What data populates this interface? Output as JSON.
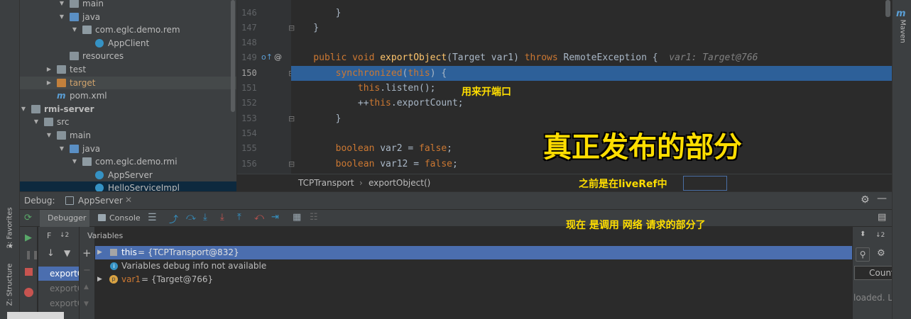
{
  "tree": {
    "rows": [
      {
        "label": "main",
        "kind": "folder"
      },
      {
        "label": "java",
        "kind": "folder-blue"
      },
      {
        "label": "com.eglc.demo.rem",
        "kind": "pkg"
      },
      {
        "label": "AppClient",
        "kind": "cls"
      },
      {
        "label": "resources",
        "kind": "folder"
      },
      {
        "label": "test",
        "kind": "folder"
      },
      {
        "label": "target",
        "kind": "folder-orange"
      },
      {
        "label": "pom.xml",
        "kind": "mvn"
      },
      {
        "label": "rmi-server",
        "kind": "folder"
      },
      {
        "label": "src",
        "kind": "folder"
      },
      {
        "label": "main",
        "kind": "folder"
      },
      {
        "label": "java",
        "kind": "folder-blue"
      },
      {
        "label": "com.eglc.demo.rmi",
        "kind": "pkg"
      },
      {
        "label": "AppServer",
        "kind": "cls"
      },
      {
        "label": "HelloServiceImpl",
        "kind": "cls"
      }
    ]
  },
  "editor": {
    "lines": [
      {
        "num": "146",
        "code": "        }"
      },
      {
        "num": "147",
        "code": "    }"
      },
      {
        "num": "148",
        "code": ""
      },
      {
        "num": "149",
        "code": "    public void exportObject(Target var1) throws RemoteException {  var1: Target@766"
      },
      {
        "num": "150",
        "code": "        synchronized(this) {"
      },
      {
        "num": "151",
        "code": "            this.listen();"
      },
      {
        "num": "152",
        "code": "            ++this.exportCount;"
      },
      {
        "num": "153",
        "code": "        }"
      },
      {
        "num": "154",
        "code": ""
      },
      {
        "num": "155",
        "code": "        boolean var2 = false;"
      },
      {
        "num": "156",
        "code": "        boolean var12 = false;"
      }
    ],
    "line149": {
      "kw1": "public void ",
      "fn": "exportObject",
      "mid": "(Target var1) ",
      "kw2": "throws",
      "rest": " RemoteException {  ",
      "hint": "var1: Target@766"
    },
    "line150": {
      "kw": "synchronized",
      "a": "(",
      "b": "this",
      "c": ") {"
    },
    "line151": {
      "kw": "this",
      "rest": ".listen();"
    },
    "line152": {
      "pre": "++",
      "kw": "this",
      "rest": ".exportCount;"
    },
    "line155": {
      "kw": "boolean",
      "rest": " var2 = ",
      "val": "false",
      "end": ";"
    },
    "line156": {
      "kw": "boolean",
      "rest": " var12 = ",
      "val": "false",
      "end": ";"
    }
  },
  "breadcrumb": {
    "a": "TCPTransport",
    "sep": "›",
    "b": "exportObject()"
  },
  "annotations": {
    "listen_note": "用来开端口",
    "big_title": "真正发布的部分",
    "before_note": "之前是在liveRef中",
    "now_note": "现在 是调用 网络 请求的部分了"
  },
  "debug": {
    "title": "Debug:",
    "config": "AppServer",
    "tabs": {
      "debugger": "Debugger",
      "console": "Console"
    },
    "frames_header": "F",
    "frames_sort": "↓2",
    "variables_header": "Variables",
    "frames": [
      "exportO",
      "exportO",
      "exportO"
    ],
    "vars": [
      {
        "name": "this",
        "value": " = {TCPTransport@832}"
      },
      {
        "name": "",
        "value": "Variables debug info not available"
      },
      {
        "name": "var1",
        "value": " = {Target@766}"
      }
    ],
    "watch": {
      "count": "Count",
      "loaded": "loaded. Lo"
    }
  },
  "side": {
    "favorites": "2: Favorites",
    "structure": "Z: Structure",
    "maven": "Maven"
  }
}
